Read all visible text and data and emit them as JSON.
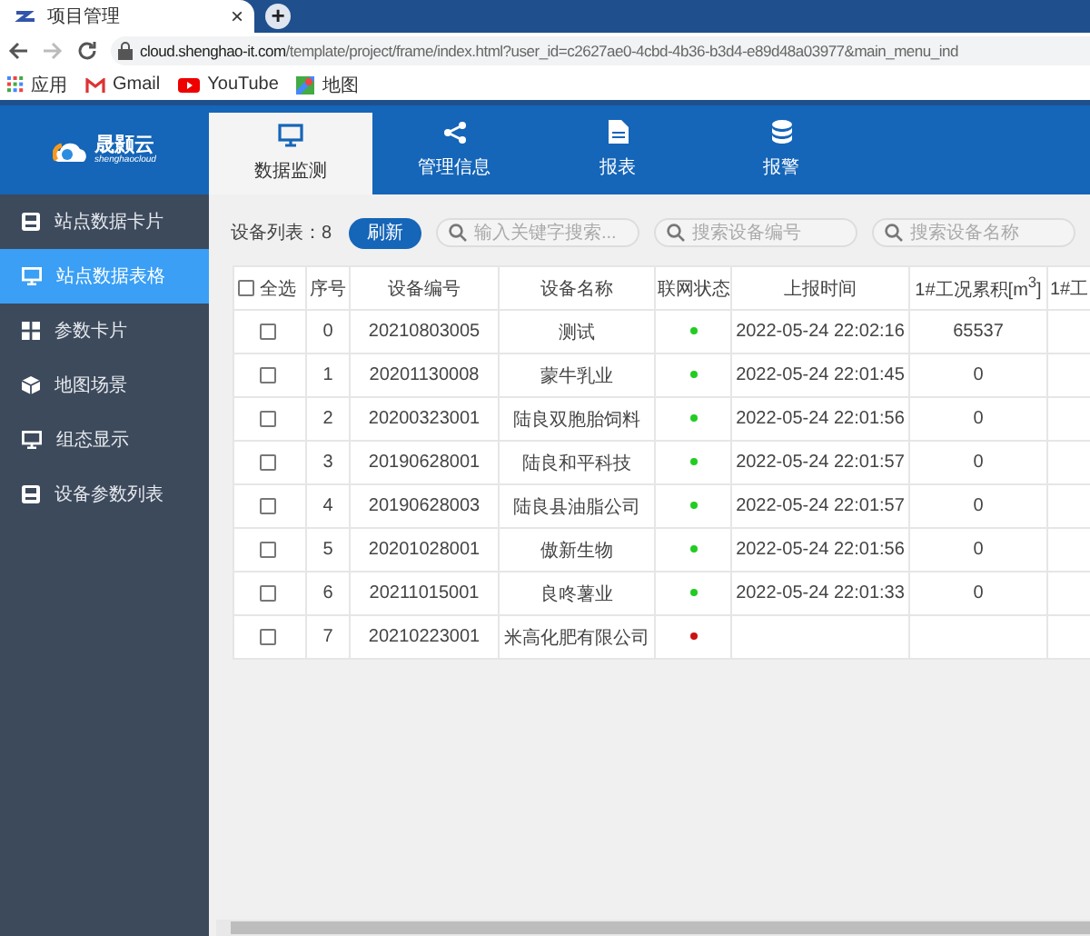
{
  "browser": {
    "tab_title": "项目管理",
    "tab_close": "×",
    "new_tab": "+",
    "url_host": "cloud.shenghao-it.com",
    "url_path": "/template/project/frame/index.html?user_id=c2627ae0-4cbd-4b36-b3d4-e89d48a03977&main_menu_ind",
    "bookmarks": [
      {
        "label": "应用"
      },
      {
        "label": "Gmail"
      },
      {
        "label": "YouTube"
      },
      {
        "label": "地图"
      }
    ]
  },
  "logo": {
    "name": "晟颢云",
    "subtitle": "shenghaocloud"
  },
  "nav_tabs": [
    {
      "label": "数据监测",
      "selected": true
    },
    {
      "label": "管理信息",
      "selected": false
    },
    {
      "label": "报表",
      "selected": false
    },
    {
      "label": "报警",
      "selected": false
    }
  ],
  "sidebar": {
    "items": [
      {
        "label": "站点数据卡片",
        "selected": false
      },
      {
        "label": "站点数据表格",
        "selected": true
      },
      {
        "label": "参数卡片",
        "selected": false
      },
      {
        "label": "地图场景",
        "selected": false
      },
      {
        "label": "组态显示",
        "selected": false
      },
      {
        "label": "设备参数列表",
        "selected": false
      }
    ]
  },
  "toolbar": {
    "count_label": "设备列表：8",
    "refresh": "刷新",
    "searches": [
      {
        "placeholder": "输入关键字搜索..."
      },
      {
        "placeholder": "搜索设备编号"
      },
      {
        "placeholder": "搜索设备名称"
      }
    ]
  },
  "table": {
    "select_all": {
      "label": "全选",
      "checked": false
    },
    "columns": [
      "序号",
      "设备编号",
      "设备名称",
      "联网状态",
      "上报时间",
      "1#工况累积[m$^{3}$]",
      "1#工"
    ],
    "rows": [
      {
        "checked": false,
        "seq": "0",
        "device_id": "20210803005",
        "device_name": "测试",
        "color": "#22cc22",
        "report_time": "2022-05-24 22:02:16",
        "value": "65537"
      },
      {
        "checked": false,
        "seq": "1",
        "device_id": "20201130008",
        "device_name": "蒙牛乳业",
        "color": "#22cc22",
        "report_time": "2022-05-24 22:01:45",
        "value": "0"
      },
      {
        "checked": false,
        "seq": "2",
        "device_id": "20200323001",
        "device_name": "陆良双胞胎饲料",
        "color": "#22cc22",
        "report_time": "2022-05-24 22:01:56",
        "value": "0"
      },
      {
        "checked": false,
        "seq": "3",
        "device_id": "20190628001",
        "device_name": "陆良和平科技",
        "color": "#22cc22",
        "report_time": "2022-05-24 22:01:57",
        "value": "0"
      },
      {
        "checked": false,
        "seq": "4",
        "device_id": "20190628003",
        "device_name": "陆良县油脂公司",
        "color": "#22cc22",
        "report_time": "2022-05-24 22:01:57",
        "value": "0"
      },
      {
        "checked": false,
        "seq": "5",
        "device_id": "20201028001",
        "device_name": "傲新生物",
        "color": "#22cc22",
        "report_time": "2022-05-24 22:01:56",
        "value": "0"
      },
      {
        "checked": false,
        "seq": "6",
        "device_id": "20211015001",
        "device_name": "良咚薯业",
        "color": "#22cc22",
        "report_time": "2022-05-24 22:01:33",
        "value": "0"
      },
      {
        "checked": false,
        "seq": "7",
        "device_id": "20210223001",
        "device_name": "米高化肥有限公司",
        "color": "#cc1111"
      }
    ]
  }
}
